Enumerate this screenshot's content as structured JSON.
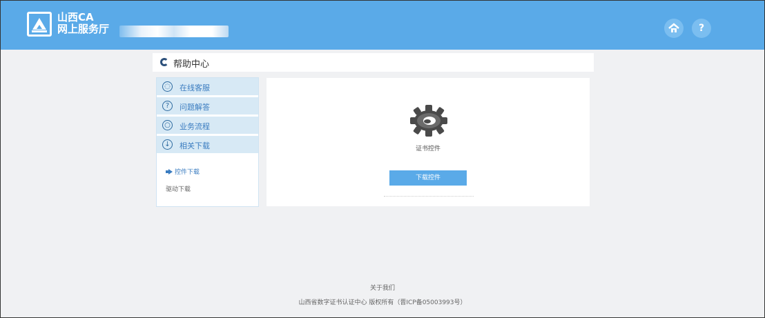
{
  "header": {
    "brand_line1": "山西CA",
    "brand_line2": "网上服务厅",
    "home_icon": "home-icon",
    "help_label": "?"
  },
  "page": {
    "title": "帮助中心"
  },
  "sidebar": {
    "items": [
      {
        "label": "在线客服",
        "icon": "support-icon"
      },
      {
        "label": "问题解答",
        "icon": "question-icon"
      },
      {
        "label": "业务流程",
        "icon": "process-icon"
      },
      {
        "label": "相关下载",
        "icon": "download-icon"
      }
    ],
    "sub_items": [
      {
        "label": "控件下载",
        "active": true
      },
      {
        "label": "驱动下载",
        "active": false
      }
    ]
  },
  "main": {
    "gear_icon": "gear-icon",
    "item_label": "证书控件",
    "download_button": "下载控件"
  },
  "footer": {
    "line1": "关于我们",
    "line2": "山西省数字证书认证中心  版权所有（晋ICP备05003993号）"
  },
  "colors": {
    "header_bg": "#5aaae8",
    "sidebar_item_bg": "#d7e9f5",
    "accent_text": "#3a7cc0"
  }
}
